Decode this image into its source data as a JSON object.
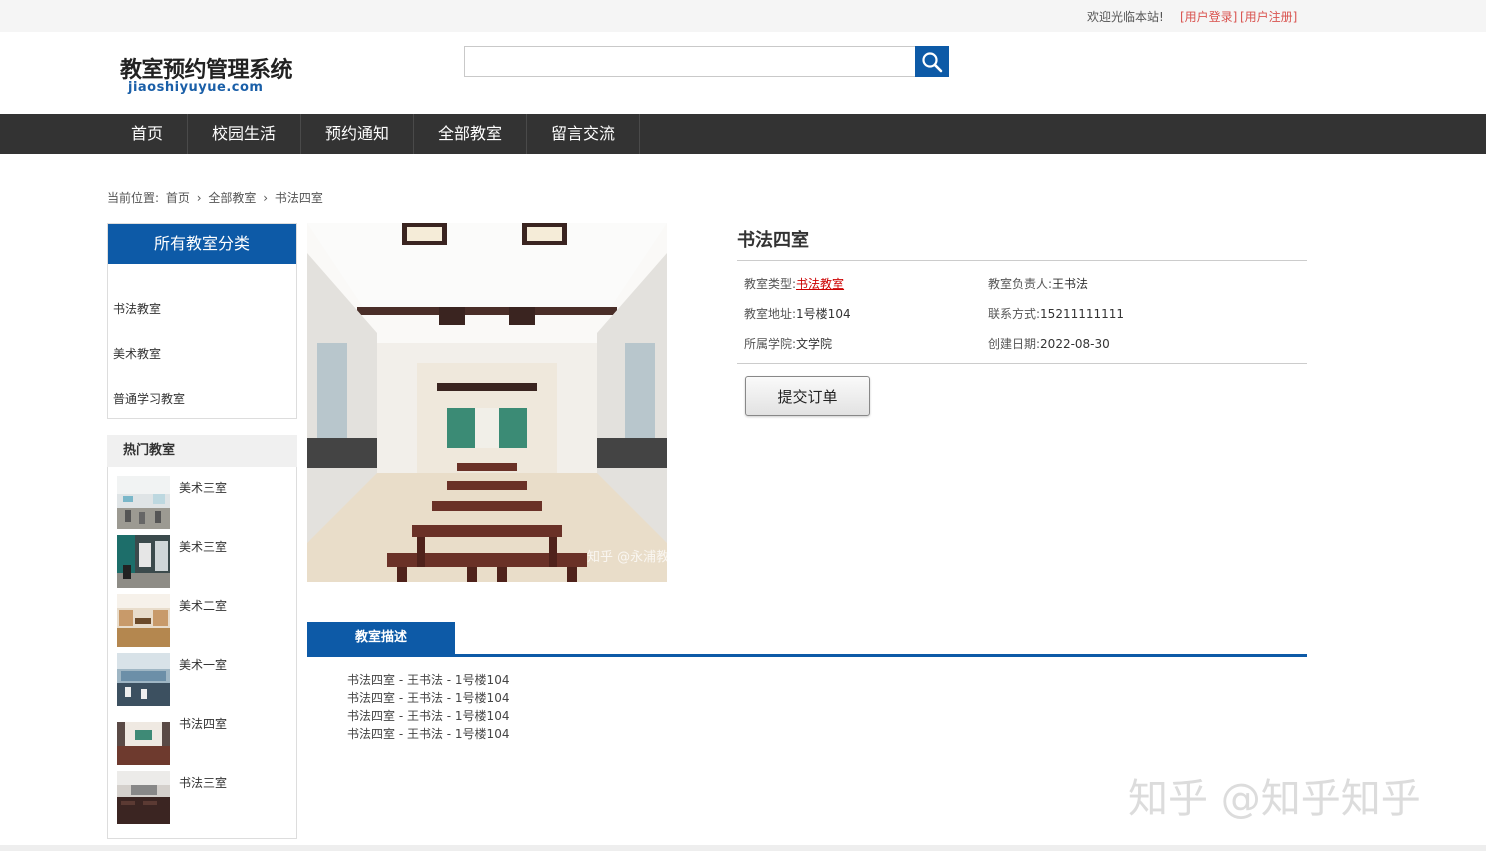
{
  "topbar": {
    "welcome": "欢迎光临本站!",
    "login": "[用户登录]",
    "register": "[用户注册]"
  },
  "logo": {
    "title": "教室预约管理系统",
    "domain": "jiaoshiyuyue.com"
  },
  "search": {
    "value": "",
    "icon": "search-icon"
  },
  "nav": [
    "首页",
    "校园生活",
    "预约通知",
    "全部教室",
    "留言交流"
  ],
  "breadcrumb": {
    "label": "当前位置:",
    "items": [
      "首页",
      "全部教室",
      "书法四室"
    ]
  },
  "categories": {
    "header": "所有教室分类",
    "items": [
      "书法教室",
      "美术教室",
      "普通学习教室"
    ]
  },
  "hot": {
    "title": "热门教室",
    "items": [
      "美术三室",
      "美术三室",
      "美术二室",
      "美术一室",
      "书法四室",
      "书法三室"
    ]
  },
  "room": {
    "name": "书法四室",
    "type_label": "教室类型:",
    "type_value": "书法教室",
    "manager_label": "教室负责人:",
    "manager_value": "王书法",
    "address_label": "教室地址:",
    "address_value": "1号楼104",
    "contact_label": "联系方式:",
    "contact_value": "15211111111",
    "college_label": "所属学院:",
    "college_value": "文学院",
    "date_label": "创建日期:",
    "date_value": "2022-08-30",
    "submit": "提交订单",
    "photo_watermark": "知乎 @永浦教育"
  },
  "description": {
    "tab": "教室描述",
    "lines": [
      "书法四室 - 王书法 - 1号楼104",
      "书法四室 - 王书法 - 1号楼104",
      "书法四室 - 王书法 - 1号楼104",
      "书法四室 - 王书法 - 1号楼104"
    ]
  },
  "watermark": "知乎 @知乎知乎",
  "colors": {
    "brand": "#0d5aa7",
    "nav_bg": "#333333",
    "link_red": "#d9534f"
  }
}
